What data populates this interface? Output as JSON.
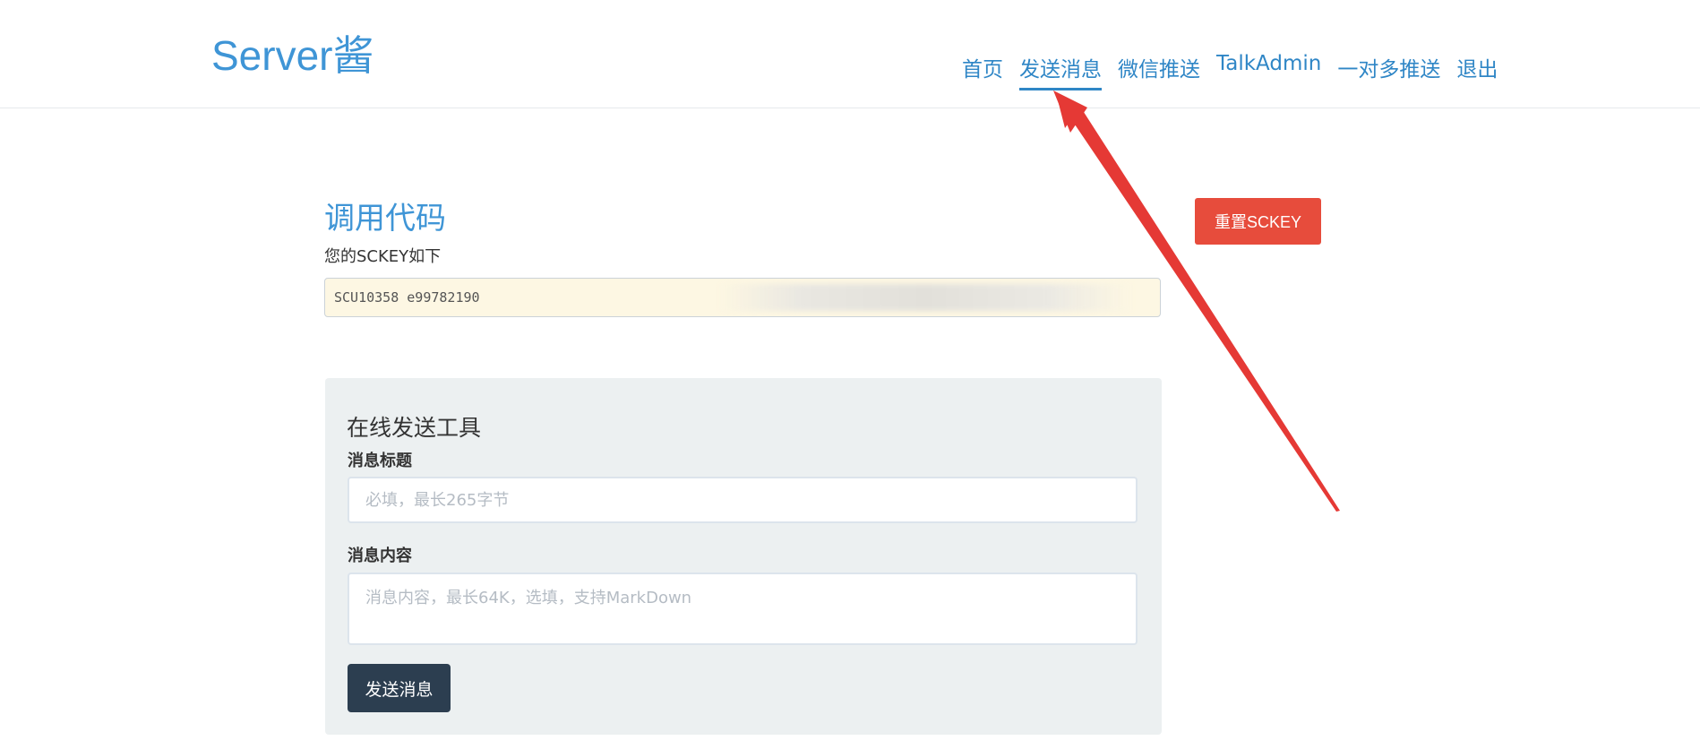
{
  "header": {
    "logo": "Server酱",
    "nav": [
      {
        "label": "首页"
      },
      {
        "label": "发送消息"
      },
      {
        "label": "微信推送"
      },
      {
        "label": "TalkAdmin"
      },
      {
        "label": "一对多推送"
      },
      {
        "label": "退出"
      }
    ],
    "active_nav": "发送消息"
  },
  "main": {
    "title": "调用代码",
    "subtitle": "您的SCKEY如下",
    "sckey_value": "SCU10358                                                  e99782190",
    "reset_button": "重置SCKEY"
  },
  "tool": {
    "title": "在线发送工具",
    "msg_title_label": "消息标题",
    "msg_title_placeholder": "必填，最长265字节",
    "msg_content_label": "消息内容",
    "msg_content_placeholder": "消息内容，最长64K，选填，支持MarkDown",
    "send_button": "发送消息"
  },
  "colors": {
    "accent": "#3f95d6",
    "danger": "#e74c3c",
    "dark": "#2c3e50",
    "panel": "#ecf0f1",
    "annotation": "#e53935"
  }
}
